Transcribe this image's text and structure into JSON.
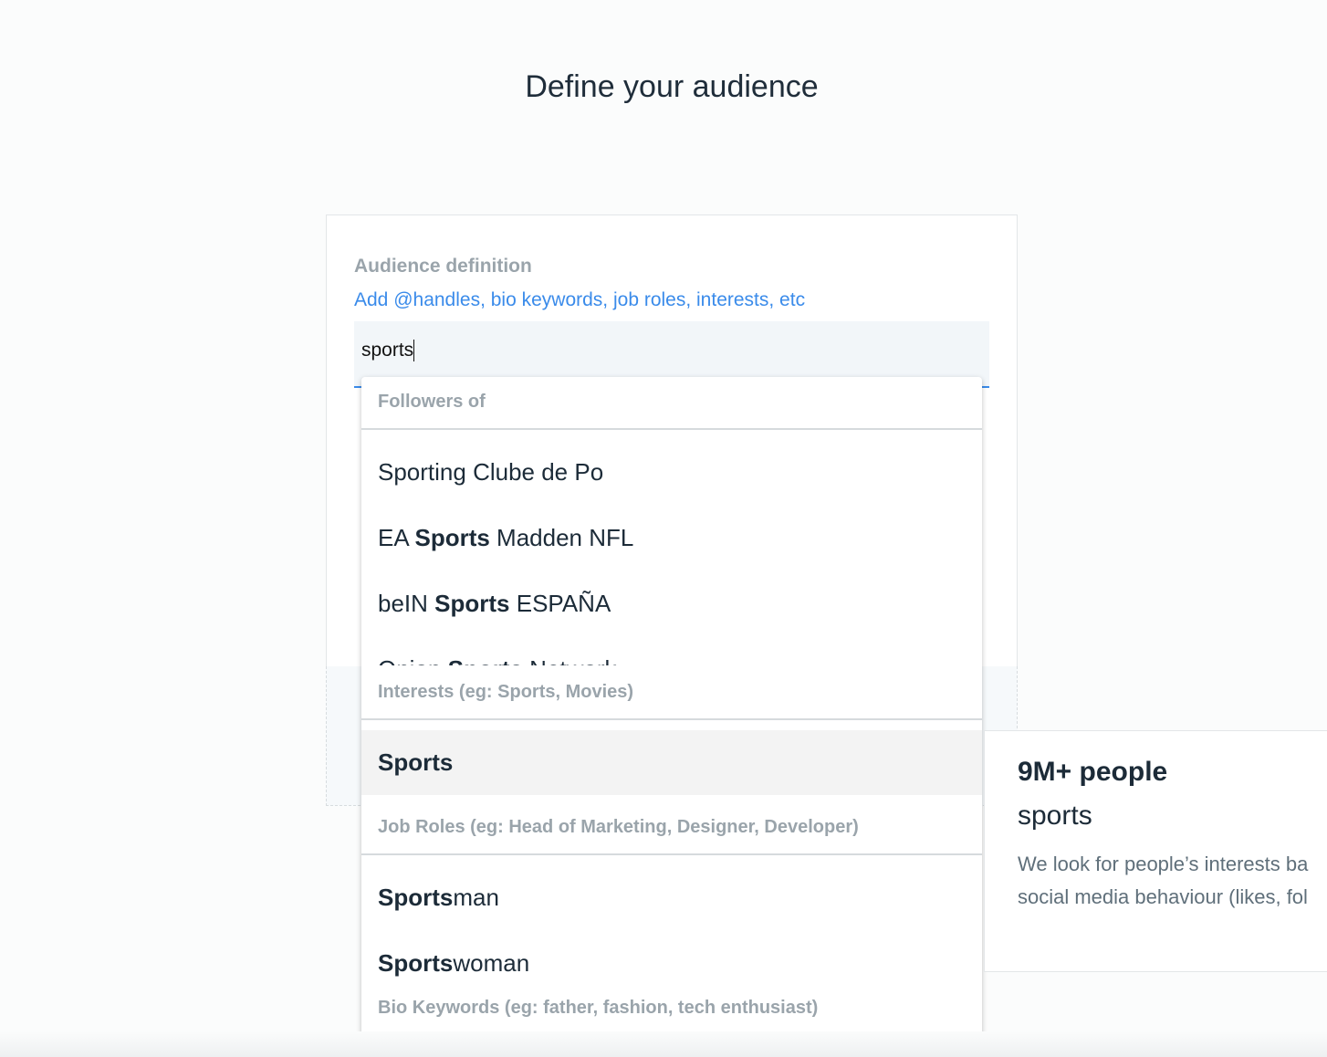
{
  "page": {
    "title": "Define your audience"
  },
  "form": {
    "label": "Audience definition",
    "hint": "Add @handles, bio keywords, job roles, interests, etc",
    "input_value": "sports"
  },
  "dropdown": {
    "sections": [
      {
        "header": "Followers of",
        "items": [
          [
            {
              "t": "Sporting Clube de Po",
              "b": false
            }
          ],
          [
            {
              "t": "EA ",
              "b": false
            },
            {
              "t": "Sports",
              "b": true
            },
            {
              "t": " Madden NFL",
              "b": false
            }
          ],
          [
            {
              "t": "beIN ",
              "b": false
            },
            {
              "t": "Sports",
              "b": true
            },
            {
              "t": " ESPAÑA",
              "b": false
            }
          ],
          [
            {
              "t": "Onion ",
              "b": false
            },
            {
              "t": "Sports",
              "b": true
            },
            {
              "t": " Network",
              "b": false
            }
          ]
        ]
      },
      {
        "header": "Interests (eg: Sports, Movies)",
        "items": [
          [
            {
              "t": "Sports",
              "b": true
            }
          ]
        ]
      },
      {
        "header": "Job Roles (eg: Head of Marketing, Designer, Developer)",
        "items": [
          [
            {
              "t": "Sports",
              "b": true
            },
            {
              "t": "man",
              "b": false
            }
          ],
          [
            {
              "t": "Sports",
              "b": true
            },
            {
              "t": "woman",
              "b": false
            }
          ]
        ]
      },
      {
        "header": "Bio Keywords (eg: father, fashion, tech enthusiast)",
        "items": []
      }
    ]
  },
  "panel": {
    "count": "9M+ people",
    "keyword": "sports",
    "desc_line1": "We look for people’s interests ba",
    "desc_line2": "social media behaviour (likes, fol"
  }
}
